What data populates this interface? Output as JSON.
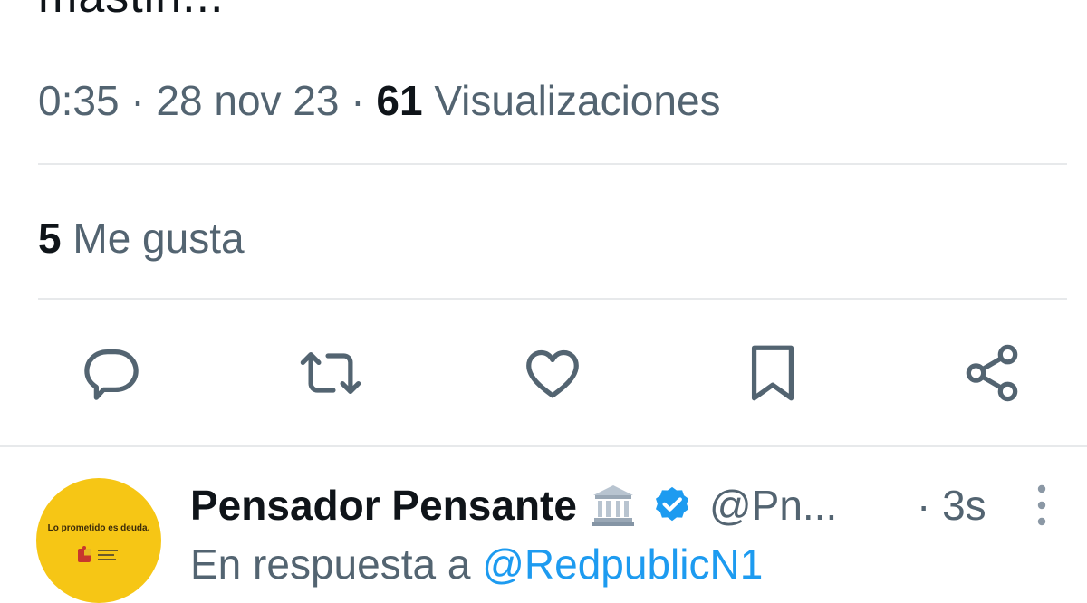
{
  "tweet": {
    "text_fragment": "mastin..."
  },
  "meta": {
    "time": "0:35",
    "separator": "·",
    "date": "28 nov 23",
    "views_count": "61",
    "views_label": "Visualizaciones"
  },
  "likes": {
    "count": "5",
    "label": "Me gusta"
  },
  "actions": {
    "icons": [
      "reply-icon",
      "retweet-icon",
      "like-icon",
      "bookmark-icon",
      "share-icon"
    ]
  },
  "reply_tweet": {
    "author_name": "Pensador Pensante",
    "author_emoji": "🏛️",
    "handle": "@Pn...",
    "time": "· 3s",
    "avatar_caption": "Lo prometido es deuda.",
    "reply_prefix": "En respuesta a",
    "reply_mention": "@RedpublicN1"
  },
  "colors": {
    "text_primary": "#0f1419",
    "text_secondary": "#536471",
    "divider": "#e7e9eb",
    "accent_blue": "#1d9bf0",
    "avatar_yellow": "#f6c615"
  }
}
